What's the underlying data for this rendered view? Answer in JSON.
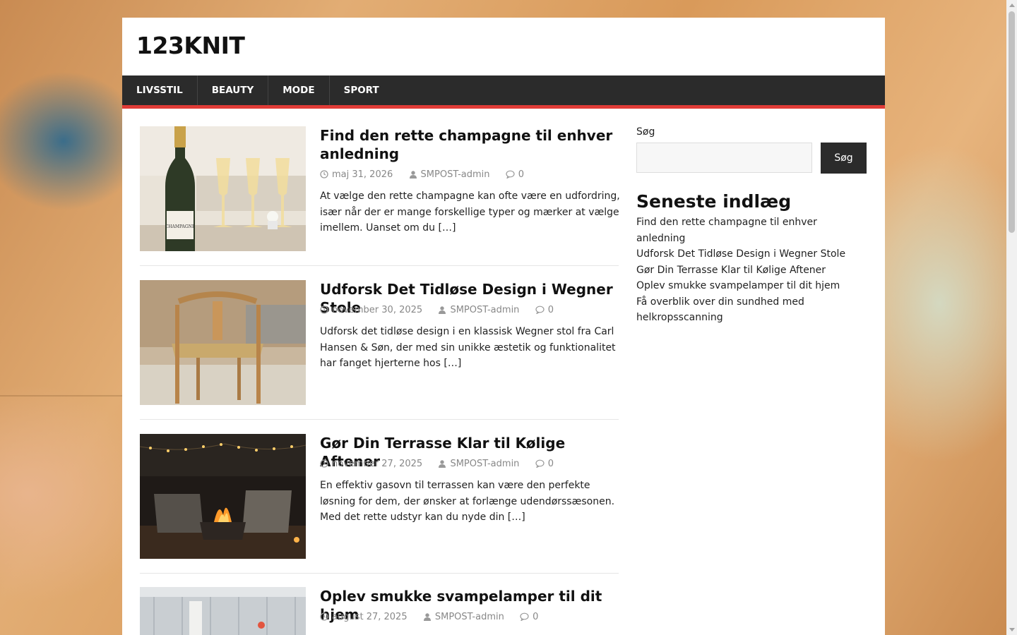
{
  "site": {
    "title": "123KNIT"
  },
  "nav": {
    "items": [
      "LIVSSTIL",
      "BEAUTY",
      "MODE",
      "SPORT"
    ]
  },
  "posts": [
    {
      "title": "Find den rette champagne til enhver anledning",
      "date": "maj 31, 2026",
      "author": "SMPOST-admin",
      "comments": "0",
      "excerpt": "At vælge den rette champagne kan ofte være en udfordring, især når der er mange forskellige typer og mærker at vælge imellem. Uanset om du",
      "more": "[…]",
      "image_label": "CHAMPAGNE"
    },
    {
      "title": "Udforsk Det Tidløse Design i Wegner Stole",
      "date": "november 30, 2025",
      "author": "SMPOST-admin",
      "comments": "0",
      "excerpt": "Udforsk det tidløse design i en klassisk Wegner stol fra Carl Hansen & Søn, der med sin unikke æstetik og funktionalitet har fanget hjerterne hos",
      "more": "[…]"
    },
    {
      "title": "Gør Din Terrasse Klar til Kølige Aftener",
      "date": "november 27, 2025",
      "author": "SMPOST-admin",
      "comments": "0",
      "excerpt": "En effektiv gasovn til terrassen kan være den perfekte løsning for dem, der ønsker at forlænge udendørssæsonen. Med det rette udstyr kan du nyde din",
      "more": "[…]"
    },
    {
      "title": "Oplev smukke svampelamper til dit hjem",
      "date": "august 27, 2025",
      "author": "SMPOST-admin",
      "comments": "0"
    }
  ],
  "sidebar": {
    "search_label": "Søg",
    "search_button": "Søg",
    "recent_title": "Seneste indlæg",
    "recent": [
      "Find den rette champagne til enhver anledning",
      "Udforsk Det Tidløse Design i Wegner Stole",
      "Gør Din Terrasse Klar til Kølige Aftener",
      "Oplev smukke svampelamper til dit hjem",
      "Få overblik over din sundhed med helkropsscanning"
    ]
  },
  "colors": {
    "nav_bg": "#2b2b2b",
    "accent": "#e03b37",
    "meta": "#888888"
  }
}
